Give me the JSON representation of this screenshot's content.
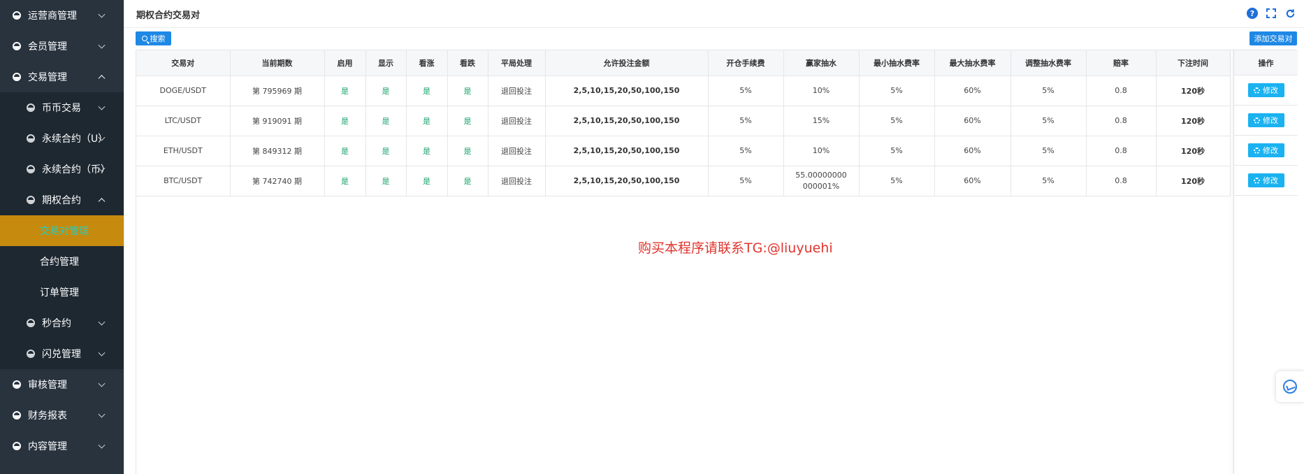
{
  "sidebar": {
    "items": [
      {
        "label": "运营商管理"
      },
      {
        "label": "会员管理"
      },
      {
        "label": "交易管理"
      },
      {
        "label": "币币交易"
      },
      {
        "label": "永续合约（U）"
      },
      {
        "label": "永续合约（币）"
      },
      {
        "label": "期权合约"
      },
      {
        "label": "交易对管理"
      },
      {
        "label": "合约管理"
      },
      {
        "label": "订单管理"
      },
      {
        "label": "秒合约"
      },
      {
        "label": "闪兑管理"
      },
      {
        "label": "审核管理"
      },
      {
        "label": "财务报表"
      },
      {
        "label": "内容管理"
      }
    ]
  },
  "header": {
    "title": "期权合约交易对",
    "icons": [
      "help-icon",
      "fullscreen-icon",
      "refresh-icon"
    ],
    "help_glyph": "?"
  },
  "toolbar": {
    "search_label": "搜索",
    "add_label": "添加交易对"
  },
  "table": {
    "columns": [
      "交易对",
      "当前期数",
      "启用",
      "显示",
      "看涨",
      "看跌",
      "平局处理",
      "允许投注金额",
      "开仓手续费",
      "赢家抽水",
      "最小抽水费率",
      "最大抽水费率",
      "调整抽水费率",
      "赔率",
      "下注时间"
    ],
    "ops_header": "操作",
    "edit_label": "修改",
    "rows": [
      {
        "pair": "DOGE/USDT",
        "period": "第 795969 期",
        "enabled": "是",
        "visible": "是",
        "rise": "是",
        "fall": "是",
        "draw": "退回投注",
        "amounts": "2,5,10,15,20,50,100,150",
        "fee": "5%",
        "winner_fee": "10%",
        "min_rate": "5%",
        "max_rate": "60%",
        "adj_rate": "5%",
        "odds": "0.8",
        "time": "120秒"
      },
      {
        "pair": "LTC/USDT",
        "period": "第 919091 期",
        "enabled": "是",
        "visible": "是",
        "rise": "是",
        "fall": "是",
        "draw": "退回投注",
        "amounts": "2,5,10,15,20,50,100,150",
        "fee": "5%",
        "winner_fee": "15%",
        "min_rate": "5%",
        "max_rate": "60%",
        "adj_rate": "5%",
        "odds": "0.8",
        "time": "120秒"
      },
      {
        "pair": "ETH/USDT",
        "period": "第 849312 期",
        "enabled": "是",
        "visible": "是",
        "rise": "是",
        "fall": "是",
        "draw": "退回投注",
        "amounts": "2,5,10,15,20,50,100,150",
        "fee": "5%",
        "winner_fee": "10%",
        "min_rate": "5%",
        "max_rate": "60%",
        "adj_rate": "5%",
        "odds": "0.8",
        "time": "120秒"
      },
      {
        "pair": "BTC/USDT",
        "period": "第 742740 期",
        "enabled": "是",
        "visible": "是",
        "rise": "是",
        "fall": "是",
        "draw": "退回投注",
        "amounts": "2,5,10,15,20,50,100,150",
        "fee": "5%",
        "winner_fee": "55.00000000000001%",
        "min_rate": "5%",
        "max_rate": "60%",
        "adj_rate": "5%",
        "odds": "0.8",
        "time": "120秒"
      }
    ]
  },
  "watermark": "购买本程序请联系TG:@liuyuehi",
  "colors": {
    "sidebar_bg": "#28333e",
    "active_bg": "#c68a0e",
    "active_text": "#1ed0c8",
    "primary": "#1e88e5",
    "yes_text": "#1aa36c",
    "watermark": "#e0342d"
  }
}
